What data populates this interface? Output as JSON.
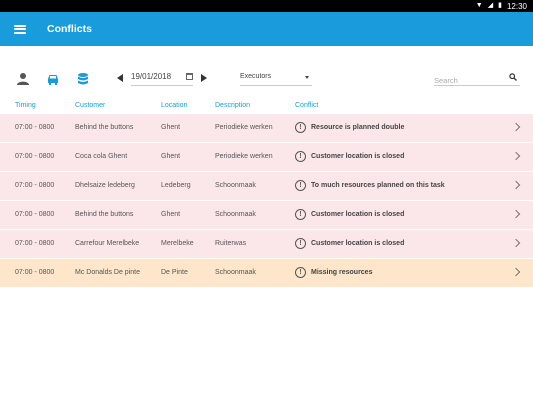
{
  "status_bar": {
    "time": "12:30"
  },
  "app_bar": {
    "title": "Conflicts"
  },
  "toolbar": {
    "date": "19/01/2018",
    "executors_label": "Executors",
    "search_placeholder": "Search"
  },
  "table": {
    "headers": [
      "Timing",
      "Customer",
      "Location",
      "Description",
      "Conflict"
    ],
    "rows": [
      {
        "timing": "07:00 - 0800",
        "customer": "Behind the buttons",
        "location": "Ghent",
        "description": "Periodieke werken",
        "conflict": "Resource is planned double"
      },
      {
        "timing": "07:00 - 0800",
        "customer": "Coca cola Ghent",
        "location": "Ghent",
        "description": "Periodieke werken",
        "conflict": "Customer location is closed"
      },
      {
        "timing": "07:00 - 0800",
        "customer": "Dhelsaize ledeberg",
        "location": "Ledeberg",
        "description": "Schoonmaak",
        "conflict": "To much resources planned on this task"
      },
      {
        "timing": "07:00 - 0800",
        "customer": "Behind the buttons",
        "location": "Ghent",
        "description": "Schoonmaak",
        "conflict": "Customer location is closed"
      },
      {
        "timing": "07:00 - 0800",
        "customer": "Carrefour Merelbeke",
        "location": "Merelbeke",
        "description": "Ruiterwas",
        "conflict": "Customer location is closed"
      },
      {
        "timing": "07:00 - 0800",
        "customer": "Mc Donalds De pinte",
        "location": "De Pinte",
        "description": "Schoonmaak",
        "conflict": "Missing resources"
      }
    ]
  },
  "colors": {
    "primary": "#1a9bdc",
    "conflict_red": "#fbe7ea",
    "conflict_orange": "#fde6c9"
  }
}
